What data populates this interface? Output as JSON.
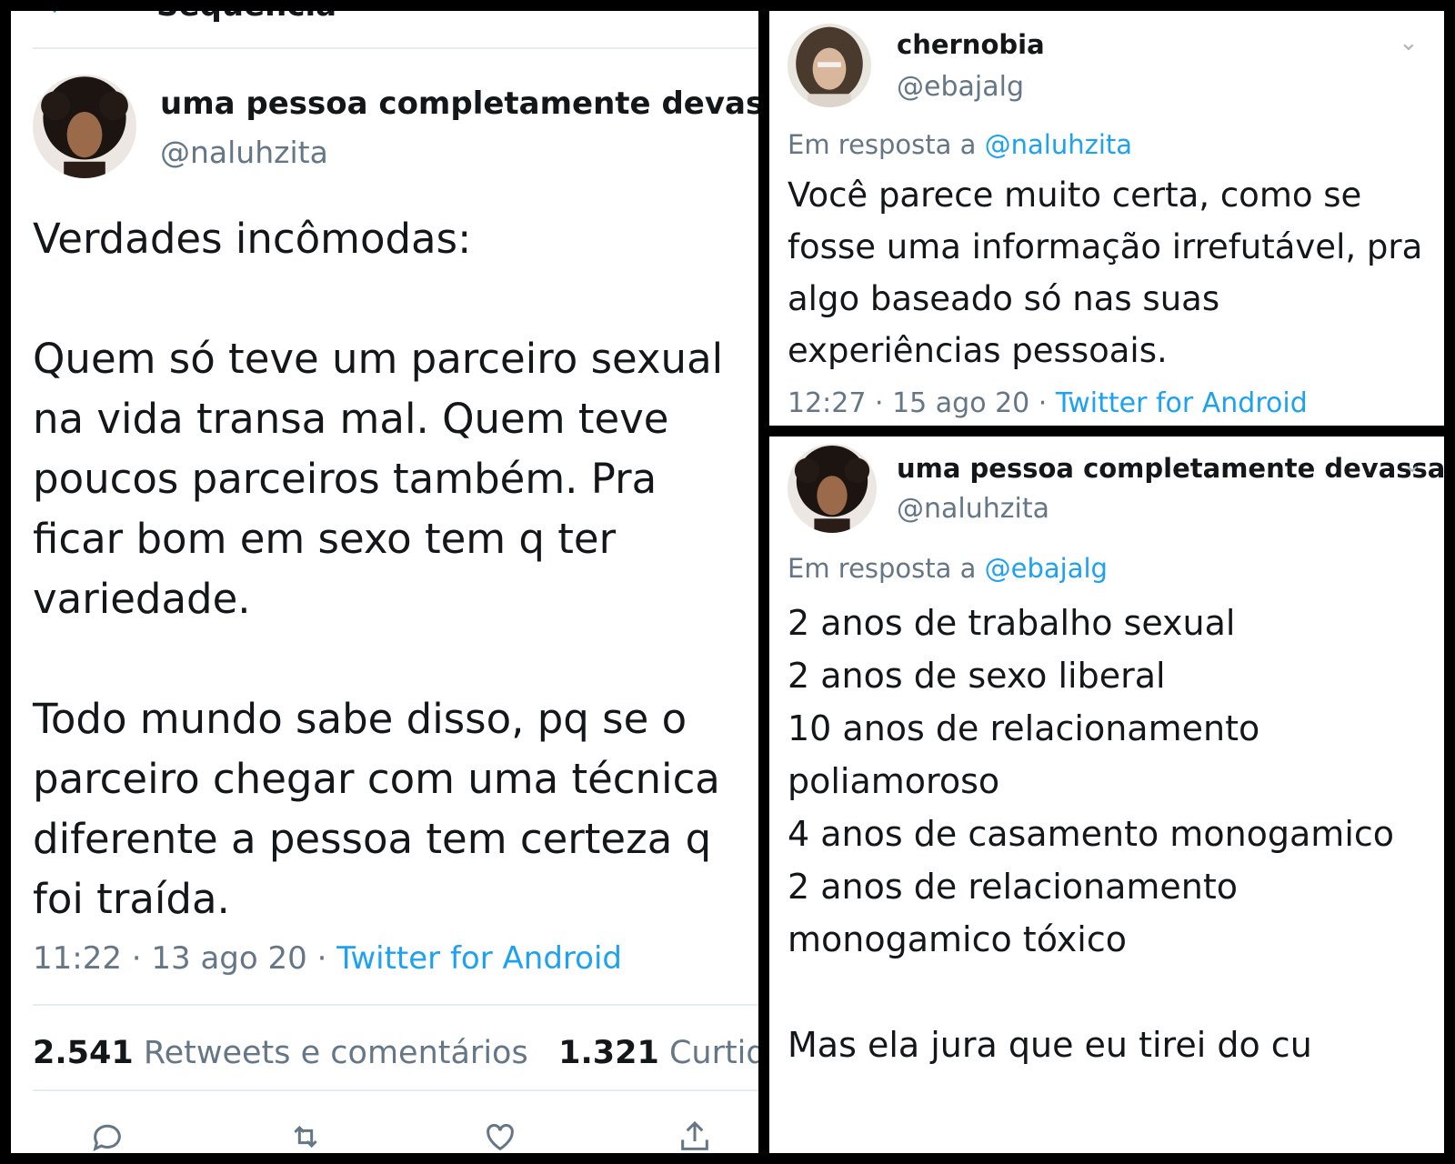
{
  "left_tweet": {
    "header_title": "Sequência",
    "name": "uma pessoa completamente devassa",
    "handle": "@naluhzita",
    "body": "Verdades incômodas:\n\nQuem só teve um parceiro sexual na vida transa mal. Quem teve poucos parceiros também. Pra ficar bom em sexo tem q ter variedade.\n\nTodo mundo sabe disso, pq se o parceiro chegar com uma técnica diferente a pessoa tem certeza q foi traída.",
    "time": "11:22 · 13 ago 20 · ",
    "source": "Twitter for Android",
    "retweets_count": "2.541",
    "retweets_label": "Retweets e comentários",
    "likes_count": "1.321",
    "likes_label": "Curtidas",
    "icons": [
      "back-arrow-icon",
      "reply-icon",
      "retweet-icon",
      "like-icon",
      "share-icon"
    ]
  },
  "reply_tweet": {
    "name": "chernobia",
    "handle": "@ebajalg",
    "reply_prefix": "Em resposta a ",
    "reply_mention": "@naluhzita",
    "body": "Você parece muito certa, como se fosse uma informação irrefutável, pra algo baseado só nas suas experiências pessoais.",
    "time": "12:27 · 15 ago 20 · ",
    "source": "Twitter for Android"
  },
  "answer_tweet": {
    "name": "uma pessoa completamente devassa",
    "handle": "@naluhzita",
    "reply_prefix": "Em resposta a ",
    "reply_mention": "@ebajalg",
    "body": "2 anos de trabalho sexual\n2 anos de sexo liberal\n10 anos de relacionamento poliamoroso\n4 anos de casamento monogamico\n2 anos de relacionamento monogamico tóxico\n\nMas ela jura que eu tirei do cu"
  },
  "colors": {
    "accent": "#1da1f2",
    "text": "#14171a",
    "muted": "#657786",
    "divider": "#e6ecf0",
    "frame": "#000000"
  }
}
